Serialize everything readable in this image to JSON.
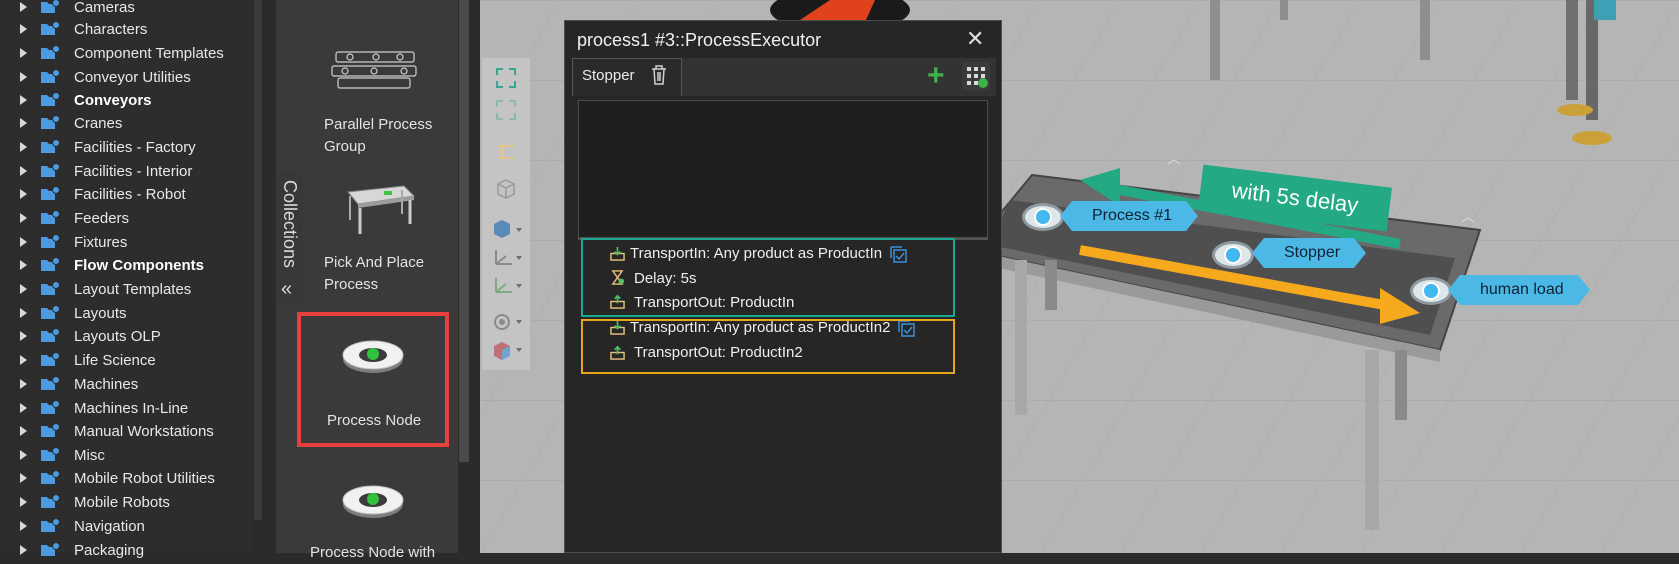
{
  "tree": {
    "items": [
      {
        "label": "Cameras",
        "bold": false
      },
      {
        "label": "Characters",
        "bold": false
      },
      {
        "label": "Component Templates",
        "bold": false
      },
      {
        "label": "Conveyor Utilities",
        "bold": false
      },
      {
        "label": "Conveyors",
        "bold": true
      },
      {
        "label": "Cranes",
        "bold": false
      },
      {
        "label": "Facilities - Factory",
        "bold": false
      },
      {
        "label": "Facilities - Interior",
        "bold": false
      },
      {
        "label": "Facilities - Robot",
        "bold": false
      },
      {
        "label": "Feeders",
        "bold": false
      },
      {
        "label": "Fixtures",
        "bold": false
      },
      {
        "label": "Flow Components",
        "bold": true
      },
      {
        "label": "Layout Templates",
        "bold": false
      },
      {
        "label": "Layouts",
        "bold": false
      },
      {
        "label": "Layouts OLP",
        "bold": false
      },
      {
        "label": "Life Science",
        "bold": false
      },
      {
        "label": "Machines",
        "bold": false
      },
      {
        "label": "Machines In-Line",
        "bold": false
      },
      {
        "label": "Manual Workstations",
        "bold": false
      },
      {
        "label": "Misc",
        "bold": false
      },
      {
        "label": "Mobile Robot Utilities",
        "bold": false
      },
      {
        "label": "Mobile Robots",
        "bold": false
      },
      {
        "label": "Navigation",
        "bold": false
      },
      {
        "label": "Packaging",
        "bold": false
      }
    ]
  },
  "collections": {
    "label": "Collections",
    "collapse_icon": "double-chevron-left-icon"
  },
  "gallery": {
    "items": [
      {
        "label": "Parallel Process Group",
        "icon": "parallel-group-icon"
      },
      {
        "label": "Pick And Place Process",
        "icon": "table-icon"
      },
      {
        "label": "Process Node",
        "icon": "process-node-icon"
      },
      {
        "label": "Process Node with",
        "icon": "process-node-icon"
      }
    ]
  },
  "dialog": {
    "title": "process1 #3::ProcessExecutor",
    "close_icon": "close-icon",
    "tab": "Stopper",
    "statements": [
      {
        "text": "TransportIn: Any product as ProductIn",
        "icon": "transport-in-icon"
      },
      {
        "text": "Delay: 5s",
        "icon": "hourglass-icon"
      },
      {
        "text": "TransportOut: ProductIn",
        "icon": "transport-out-icon"
      },
      {
        "text": "TransportIn: Any product as ProductIn2",
        "icon": "transport-in-icon"
      },
      {
        "text": "TransportOut: ProductIn2",
        "icon": "transport-out-icon"
      }
    ]
  },
  "scene": {
    "tags": {
      "process1": "Process #1",
      "stopper": "Stopper",
      "human_load": "human load"
    },
    "banner": "with 5s delay"
  },
  "colors": {
    "highlight_red": "#e8413b",
    "teal": "#1aa88e",
    "orange": "#e8a51b",
    "tag_blue": "#4cb8e5",
    "add_green": "#3fb14a"
  }
}
